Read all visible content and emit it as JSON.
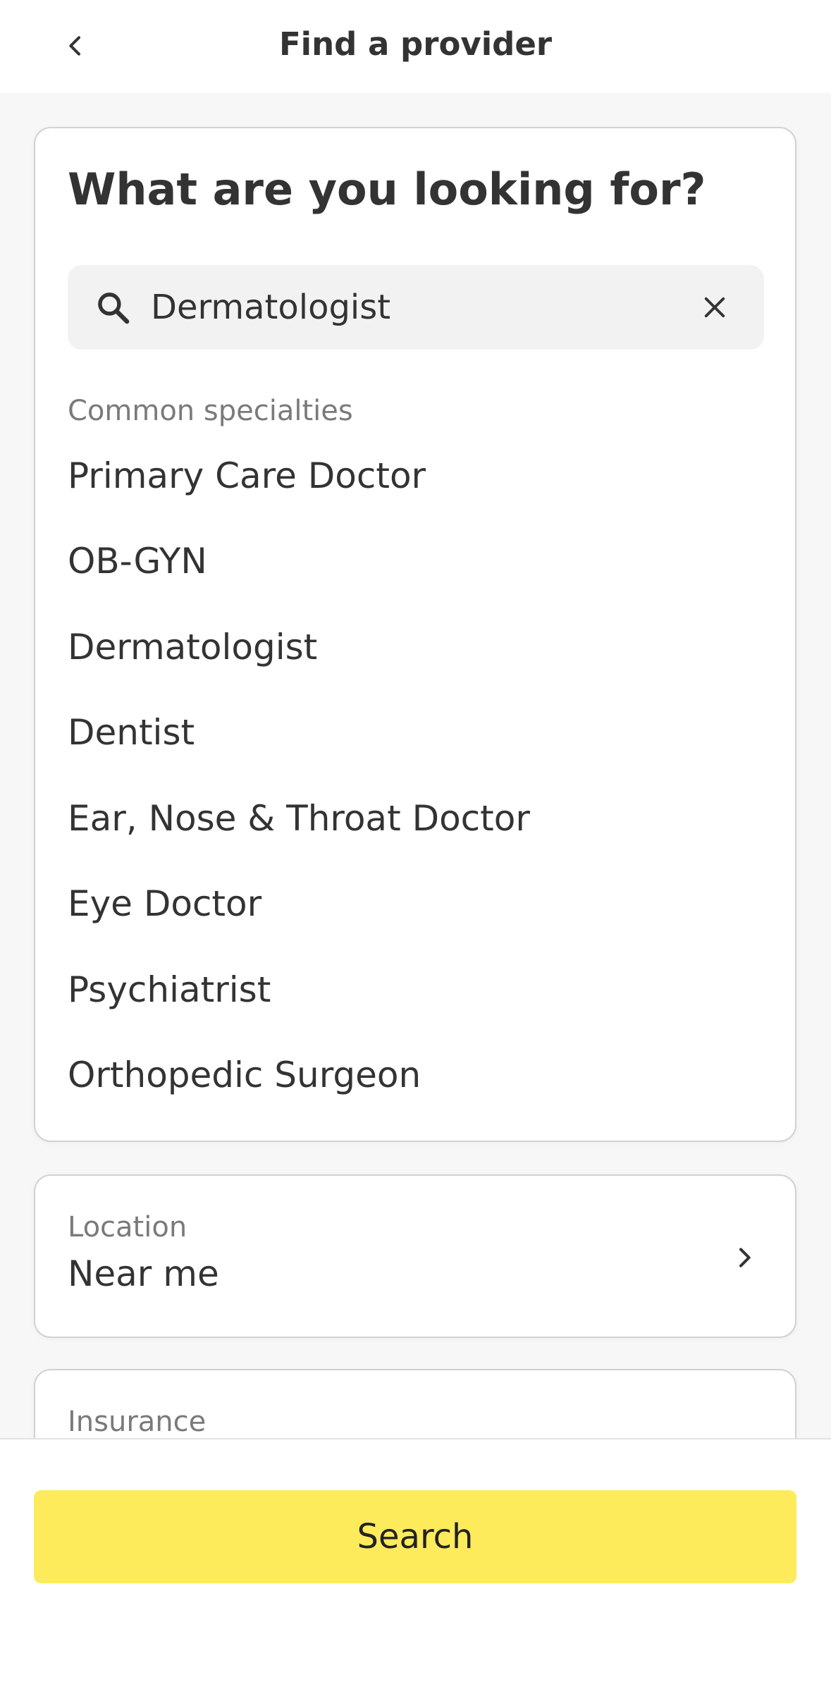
{
  "header": {
    "title": "Find a provider"
  },
  "search_card": {
    "title": "What are you looking for?",
    "search_value": "Dermatologist",
    "section_label": "Common specialties",
    "specialties": [
      "Primary Care Doctor",
      "OB-GYN",
      "Dermatologist",
      "Dentist",
      "Ear, Nose & Throat Doctor",
      "Eye Doctor",
      "Psychiatrist",
      "Orthopedic Surgeon"
    ]
  },
  "location": {
    "label": "Location",
    "value": "Near me"
  },
  "insurance": {
    "label": "Insurance"
  },
  "footer": {
    "search_label": "Search"
  },
  "icons": {
    "back": "chevron-left-icon",
    "search": "search-icon",
    "clear": "close-icon",
    "location": "chevron-right-icon"
  },
  "colors": {
    "accent": "#fdeb5c",
    "text": "#333333",
    "muted": "#7a7a7a"
  }
}
